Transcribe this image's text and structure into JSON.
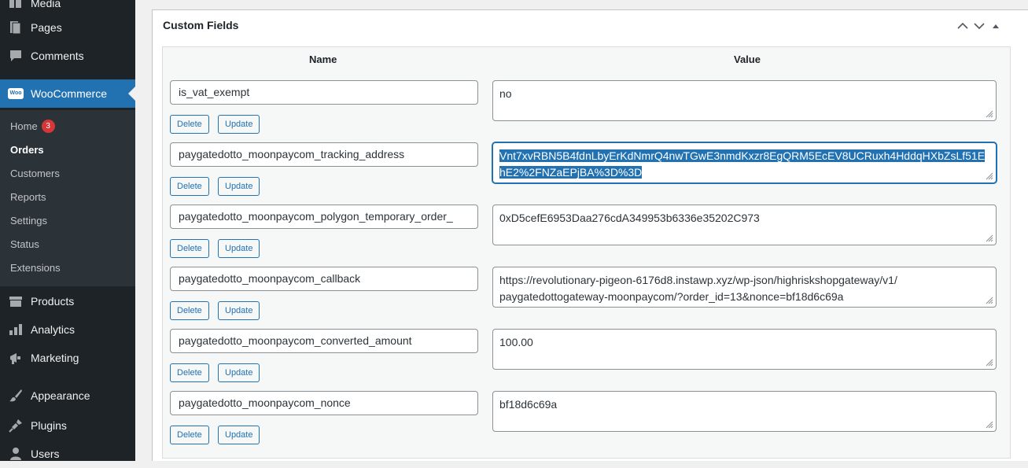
{
  "sidebar": {
    "items": [
      {
        "label": "Media",
        "icon": "media-icon"
      },
      {
        "label": "Pages",
        "icon": "pages-icon"
      },
      {
        "label": "Comments",
        "icon": "comments-icon"
      },
      {
        "label": "WooCommerce",
        "icon": "woocommerce-icon",
        "icon_text": "Woo"
      },
      {
        "label": "Products",
        "icon": "products-icon"
      },
      {
        "label": "Analytics",
        "icon": "analytics-icon"
      },
      {
        "label": "Marketing",
        "icon": "marketing-icon"
      },
      {
        "label": "Appearance",
        "icon": "appearance-icon"
      },
      {
        "label": "Plugins",
        "icon": "plugins-icon"
      },
      {
        "label": "Users",
        "icon": "users-icon"
      }
    ],
    "submenu": [
      {
        "label": "Home",
        "badge": "3"
      },
      {
        "label": "Orders"
      },
      {
        "label": "Customers"
      },
      {
        "label": "Reports"
      },
      {
        "label": "Settings"
      },
      {
        "label": "Status"
      },
      {
        "label": "Extensions"
      }
    ]
  },
  "panel": {
    "title": "Custom Fields",
    "columns": {
      "name": "Name",
      "value": "Value"
    },
    "delete_label": "Delete",
    "update_label": "Update",
    "rows": [
      {
        "name": "is_vat_exempt",
        "value": "no"
      },
      {
        "name": "paygatedotto_moonpaycom_tracking_address",
        "value_line1": "Vnt7xvRBN5B4fdnLbyErKdNmrQ4nwTGwE3nmdKxzr8EgQRM5EcEV8UCRuxh4HddqHXbZsLf51E",
        "value_line2": "hE2%2FNZaEPjBA%3D%3D"
      },
      {
        "name": "paygatedotto_moonpaycom_polygon_temporary_order_",
        "value": "0xD5cefE6953Daa276cdA349953b6336e35202C973"
      },
      {
        "name": "paygatedotto_moonpaycom_callback",
        "value_line1": "https://revolutionary-pigeon-6176d8.instawp.xyz/wp-json/highriskshopgateway/v1/",
        "value_line2": "paygatedottogateway-moonpaycom/?order_id=13&nonce=bf18d6c69a"
      },
      {
        "name": "paygatedotto_moonpaycom_converted_amount",
        "value": "100.00"
      },
      {
        "name": "paygatedotto_moonpaycom_nonce",
        "value": "bf18d6c69a"
      }
    ]
  },
  "colors": {
    "accent": "#2271b1",
    "sidebar": "#1d2327",
    "badge": "#d63638"
  }
}
